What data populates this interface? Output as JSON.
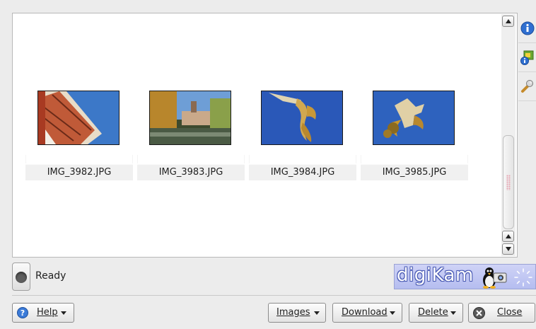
{
  "thumbnails": [
    {
      "filename": "IMG_3982.JPG"
    },
    {
      "filename": "IMG_3983.JPG"
    },
    {
      "filename": "IMG_3984.JPG"
    },
    {
      "filename": "IMG_3985.JPG"
    }
  ],
  "side_tabs": [
    {
      "icon": "info-icon"
    },
    {
      "icon": "metadata-icon"
    },
    {
      "icon": "tools-icon"
    }
  ],
  "status": {
    "text": "Ready"
  },
  "brand": {
    "text": "digiKam"
  },
  "buttons": {
    "help": "Help",
    "images": "Images",
    "download": "Download",
    "delete": "Delete",
    "close": "Close"
  },
  "colors": {
    "window_bg": "#ececec",
    "brand_bg": "#b5bdf0",
    "status_led": "#5e5e5e"
  }
}
